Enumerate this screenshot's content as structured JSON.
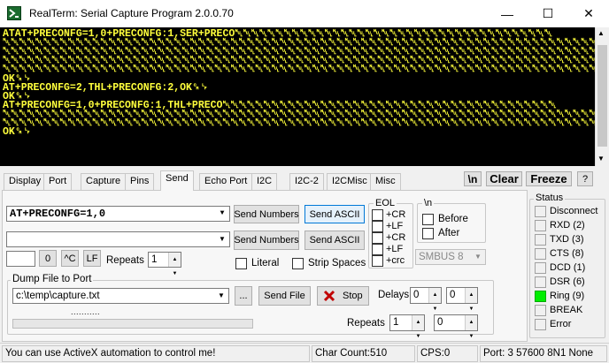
{
  "window": {
    "title": "RealTerm: Serial Capture Program 2.0.0.70",
    "minimize": "—",
    "maximize": "☐",
    "close": "✕"
  },
  "terminal": {
    "text_color": "#ffff3c",
    "lines": [
      "ATAT+PRECONFG=1,0+PRECONFG:1,SER+PRECO␀␀␀␀␀␀␀␀␀␀␀␀␀␀␀␀␀␀␀␀␀␀␀␀␀␀␀␀␀␀␀␀␀␀␀␀␀␀␀",
      "␀␀␀␀␀␀␀␀␀␀␀␀␀␀␀␀␀␀␀␀␀␀␀␀␀␀␀␀␀␀␀␀␀␀␀␀␀␀␀␀␀␀␀␀␀␀␀␀␀␀␀␀␀␀␀␀␀␀␀␀␀␀␀␀␀␀␀␀␀␀␀␀␀␀␀␀␀␀␀␀␀␀␀␀␀␀␀␀␀␀",
      "␀␀␀␀␀␀␀␀␀␀␀␀␀␀␀␀␀␀␀␀␀␀␀␀␀␀␀␀␀␀␀␀␀␀␀␀␀␀␀␀␀␀␀␀␀␀␀␀␀␀␀␀␀␀␀␀␀␀␀␀␀␀␀␀␀␀␀␀␀␀␀␀␀␀␀␀␀␀␀␀␀␀␀␀␀␀␀␀␀␀",
      "␀␀␀␀␀␀␀␀␀␀␀␀␀␀␀␀␀␀␀␀␀␀␀␀␀␀␀␀␀␀␀␀␀␀␀␀␀␀␀␀␀␀␀␀␀␀␀␀␀␀␀␀␀␀␀␀␀␀␀␀␀␀␀␀␀␀␀␀␀␀␀␀␀␀␀␀␀␀␀␀␀␀␀␀␀␀␀␀␀␀",
      "␀␀␀␀␀␀␀␀␀␀␀␀␀␀␀␀␀␀␀␀␀␀␀␀␀␀␀␀␀␀␀␀␀␀␀␀␀␀␀␀␀␀␀␀␀␀␀␀␀␀␀␀␀␀␀␀␀␀␀␀␀␀␀␀␀␀␀␀␀␀␀␀␀␀␀␀␀␀␀␀␀␀␀␀␀␀␀␀␀␀",
      "OK␍␊",
      "AT+PRECONFG=2,THL+PRECONFG:2,OK␍␊",
      "OK␍␊",
      "AT+PRECONFG=1,0+PRECONFG:1,THL+PRECO␀␀␀␀␀␀␀␀␀␀␀␀␀␀␀␀␀␀␀␀␀␀␀␀␀␀␀␀␀␀␀␀␀␀␀␀␀␀␀␀␀",
      "␀␀␀␀␀␀␀␀␀␀␀␀␀␀␀␀␀␀␀␀␀␀␀␀␀␀␀␀␀␀␀␀␀␀␀␀␀␀␀␀␀␀␀␀␀␀␀␀␀␀␀␀␀␀␀␀␀␀␀␀␀␀␀␀␀␀␀␀␀␀␀␀␀␀␀␀␀␀␀␀␀␀␀␀␀␀␀␀␀␀",
      "␀␀␀␀␀␀␀␀␀␀␀␀␀␀␀␀␀␀␀␀␀␀␀␀␀␀␀␀␀␀␀␀␀␀␀␀␀␀␀␀␀␀␀␀␀␀␀␀␀␀␀␀␀␀␀␀␀␀␀␀␀␀␀␀␀␀␀␀␀␀␀␀␀␀␀␀␀␀␀␀␀␀␀␀␀␀␀␀␀␀",
      "OK␍␊"
    ]
  },
  "tabs": [
    "Display",
    "Port",
    "Capture",
    "Pins",
    "Send",
    "Echo Port",
    "I2C",
    "I2C-2",
    "I2CMisc",
    "Misc"
  ],
  "top_buttons": {
    "newline": "\\n",
    "clear": "Clear",
    "freeze": "Freeze",
    "help": "?"
  },
  "send": {
    "line1_value": "AT+PRECONFG=1,0",
    "line2_value": "",
    "send_numbers": "Send Numbers",
    "send_ascii": "Send ASCII",
    "char_value": "",
    "zero_btn": "0",
    "ctrl_c": "^C",
    "lf_btn": "LF",
    "repeats_label": "Repeats",
    "repeats_value": "1",
    "literal": "Literal",
    "strip_spaces": "Strip Spaces",
    "eol_title": "EOL",
    "eol_options": [
      "+CR",
      "+LF",
      "+CR",
      "+LF",
      "+crc"
    ],
    "nl_title": "\\n",
    "before": "Before",
    "after": "After",
    "smbus_value": "SMBUS 8"
  },
  "dump": {
    "title": "Dump File to Port",
    "file_value": "c:\\temp\\capture.txt",
    "browse": "...",
    "send_file": "Send File",
    "stop": "Stop",
    "delays_label": "Delays",
    "delay1": "0",
    "delay2": "0",
    "repeats_label": "Repeats",
    "repeats1": "1",
    "repeats2": "0",
    "progress_text": "..........."
  },
  "status": {
    "title": "Status",
    "items": [
      {
        "label": "Disconnect",
        "on": false
      },
      {
        "label": "RXD (2)",
        "on": false
      },
      {
        "label": "TXD (3)",
        "on": false
      },
      {
        "label": "CTS (8)",
        "on": false
      },
      {
        "label": "DCD (1)",
        "on": false
      },
      {
        "label": "DSR (6)",
        "on": false
      },
      {
        "label": "Ring (9)",
        "on": true
      },
      {
        "label": "BREAK",
        "on": false
      },
      {
        "label": "Error",
        "on": false
      }
    ],
    "on_color": "#00ee00"
  },
  "statusbar": {
    "message": "You can use ActiveX automation to control me!",
    "char_count": "Char Count:510",
    "cps": "CPS:0",
    "port": "Port: 3 57600 8N1 None"
  }
}
